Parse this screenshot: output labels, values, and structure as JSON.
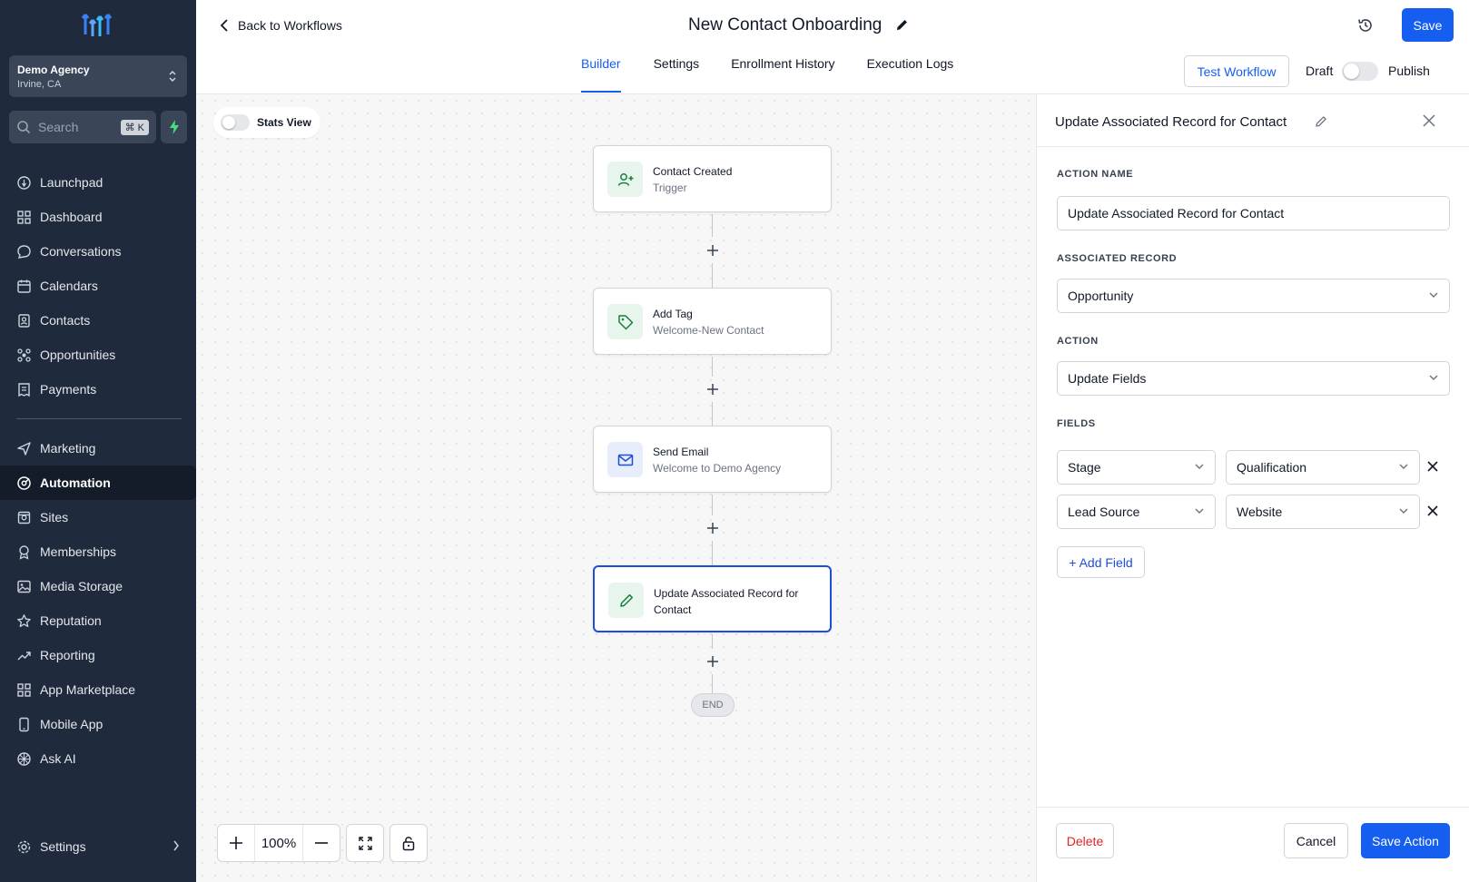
{
  "sidebar": {
    "agency_name": "Demo Agency",
    "agency_location": "Irvine, CA",
    "search_placeholder": "Search",
    "search_shortcut": "⌘ K",
    "items": [
      {
        "label": "Launchpad",
        "icon": "launchpad-icon"
      },
      {
        "label": "Dashboard",
        "icon": "dashboard-icon"
      },
      {
        "label": "Conversations",
        "icon": "chat-icon"
      },
      {
        "label": "Calendars",
        "icon": "calendar-icon"
      },
      {
        "label": "Contacts",
        "icon": "contacts-icon"
      },
      {
        "label": "Opportunities",
        "icon": "opportunities-icon"
      },
      {
        "label": "Payments",
        "icon": "payments-icon"
      },
      {
        "label": "Marketing",
        "icon": "send-icon"
      },
      {
        "label": "Automation",
        "icon": "automation-icon",
        "active": true
      },
      {
        "label": "Sites",
        "icon": "sites-icon"
      },
      {
        "label": "Memberships",
        "icon": "award-icon"
      },
      {
        "label": "Media Storage",
        "icon": "image-icon"
      },
      {
        "label": "Reputation",
        "icon": "star-icon"
      },
      {
        "label": "Reporting",
        "icon": "trend-icon"
      },
      {
        "label": "App Marketplace",
        "icon": "grid-icon"
      },
      {
        "label": "Mobile App",
        "icon": "phone-icon"
      },
      {
        "label": "Ask AI",
        "icon": "ai-icon"
      }
    ],
    "settings_label": "Settings"
  },
  "header": {
    "back_label": "Back to Workflows",
    "title": "New Contact Onboarding",
    "save_label": "Save",
    "tabs": [
      "Builder",
      "Settings",
      "Enrollment History",
      "Execution Logs"
    ],
    "active_tab": "Builder",
    "test_label": "Test Workflow",
    "draft_label": "Draft",
    "publish_label": "Publish"
  },
  "canvas": {
    "stats_label": "Stats View",
    "nodes": [
      {
        "title": "Contact Created",
        "subtitle": "Trigger",
        "icon": "user-plus-icon"
      },
      {
        "title": "Add Tag",
        "subtitle": "Welcome-New Contact",
        "icon": "tag-icon"
      },
      {
        "title": "Send Email",
        "subtitle": "Welcome to Demo Agency",
        "icon": "mail-icon"
      },
      {
        "title": "Update Associated Record for Contact",
        "subtitle": "",
        "icon": "pencil-icon"
      }
    ],
    "end_label": "END",
    "zoom_level": "100%"
  },
  "panel": {
    "title": "Update Associated Record for Contact",
    "action_name_label": "ACTION NAME",
    "action_name_value": "Update Associated Record for Contact",
    "associated_record_label": "ASSOCIATED RECORD",
    "associated_record_value": "Opportunity",
    "action_label": "ACTION",
    "action_value": "Update Fields",
    "fields_label": "FIELDS",
    "fields": [
      {
        "field": "Stage",
        "value": "Qualification"
      },
      {
        "field": "Lead Source",
        "value": "Website"
      }
    ],
    "add_field_label": "+ Add Field",
    "delete_label": "Delete",
    "cancel_label": "Cancel",
    "save_action_label": "Save Action"
  },
  "colors": {
    "accent": "#155eef",
    "sidebar_bg": "#1f2a3c",
    "danger": "#dc2626",
    "trigger_icon_bg": "#e8f5ec",
    "email_icon_bg": "#e8edfb"
  }
}
